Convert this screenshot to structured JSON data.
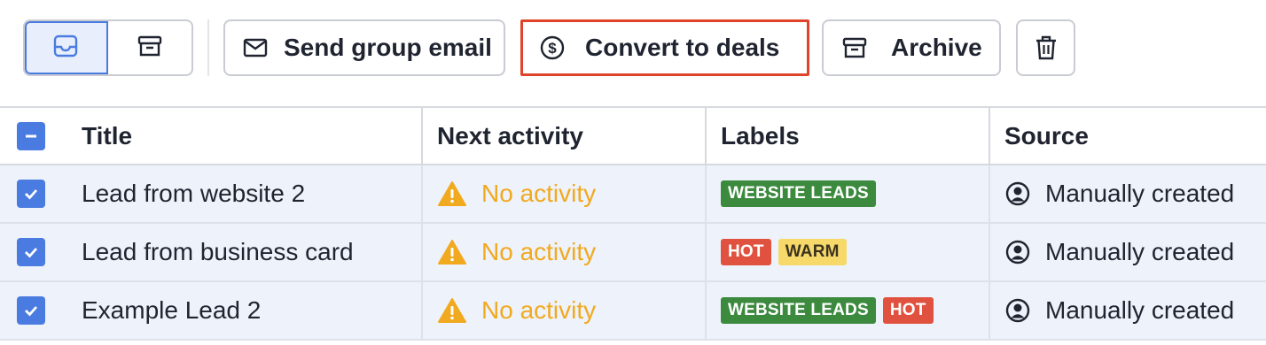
{
  "toolbar": {
    "view_toggle": [
      {
        "icon": "inbox-icon",
        "active": true
      },
      {
        "icon": "archive-box-icon",
        "active": false
      }
    ],
    "send_email_label": "Send group email",
    "convert_label": "Convert to deals",
    "archive_label": "Archive",
    "delete_icon": "trash-icon"
  },
  "table": {
    "headers": {
      "title": "Title",
      "next_activity": "Next activity",
      "labels": "Labels",
      "source": "Source"
    },
    "rows": [
      {
        "checked": true,
        "title": "Lead from website 2",
        "next_activity": "No activity",
        "labels": [
          {
            "text": "WEBSITE LEADS",
            "color": "#3b8a3e"
          }
        ],
        "source": "Manually created"
      },
      {
        "checked": true,
        "title": "Lead from business card",
        "next_activity": "No activity",
        "labels": [
          {
            "text": "HOT",
            "color": "#e0523f"
          },
          {
            "text": "WARM",
            "color": "#f7d96a"
          }
        ],
        "source": "Manually created"
      },
      {
        "checked": true,
        "title": "Example Lead 2",
        "next_activity": "No activity",
        "labels": [
          {
            "text": "WEBSITE LEADS",
            "color": "#3b8a3e"
          },
          {
            "text": "HOT",
            "color": "#e0523f"
          }
        ],
        "source": "Manually created"
      }
    ]
  },
  "colors": {
    "accent": "#4a7be0",
    "warning": "#f1a91f",
    "highlight_border": "#e0432a"
  }
}
